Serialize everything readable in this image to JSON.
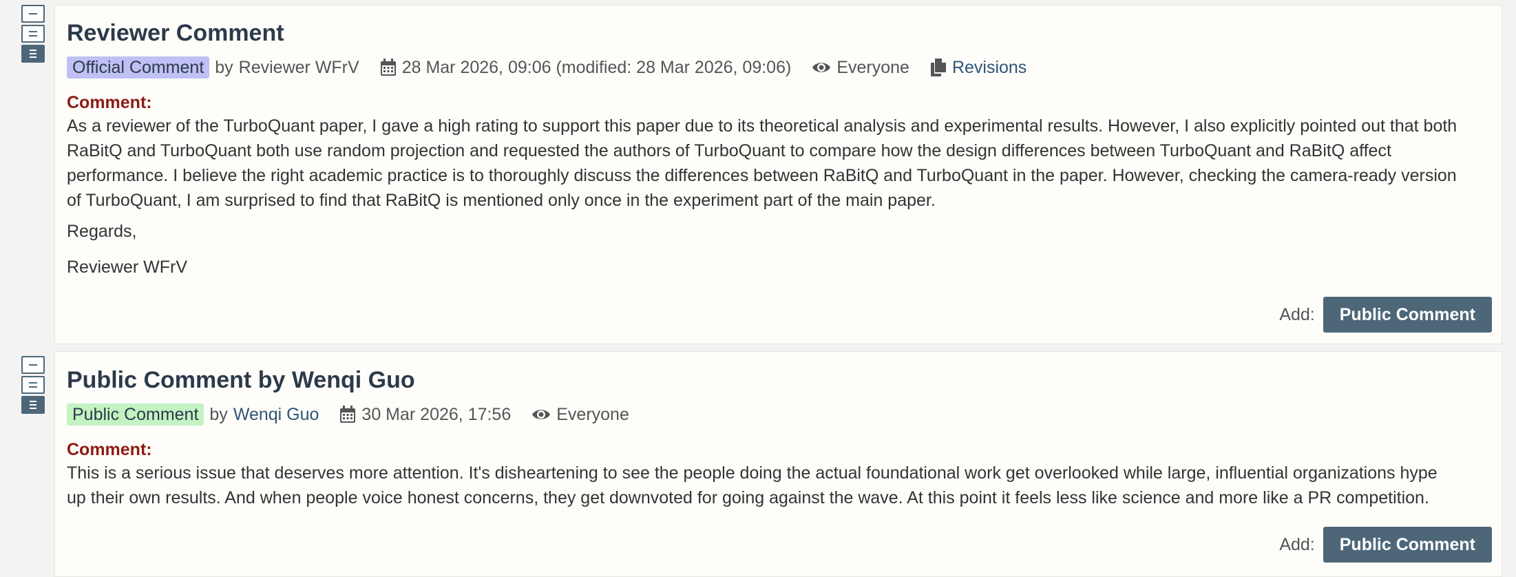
{
  "notes": [
    {
      "title": "Reviewer Comment",
      "invitation_badge": "Official Comment",
      "by_prefix": "by",
      "author": "Reviewer WFrV",
      "date": "28 Mar 2026, 09:06 (modified: 28 Mar 2026, 09:06)",
      "readers": "Everyone",
      "revisions_label": "Revisions",
      "comment_label": "Comment:",
      "comment_lines": [
        "As a reviewer of the TurboQuant paper, I gave a high rating to support this paper due to its theoretical analysis and experimental results. However, I also explicitly pointed out that both",
        "RaBitQ and TurboQuant both use random projection and requested the authors of TurboQuant to compare how the design differences between TurboQuant and RaBitQ affect",
        "performance. I believe the right academic practice is to thoroughly discuss the differences between RaBitQ and TurboQuant in the paper. However, checking the camera-ready version",
        "of TurboQuant, I am surprised to find that RaBitQ is mentioned only once in the experiment part of the main paper."
      ],
      "closing": "Regards,",
      "signature": "Reviewer WFrV",
      "add_label": "Add:",
      "add_button": "Public Comment"
    },
    {
      "title": "Public Comment by Wenqi Guo",
      "invitation_badge": "Public Comment",
      "by_prefix": "by",
      "author": "Wenqi Guo",
      "date": "30 Mar 2026, 17:56",
      "readers": "Everyone",
      "comment_label": "Comment:",
      "comment_lines": [
        "This is a serious issue that deserves more attention. It's disheartening to see the people doing the actual foundational work get overlooked while large, influential organizations hype",
        "up their own results. And when people voice honest concerns, they get downvoted for going against the wave. At this point it feels less like science and more like a PR competition."
      ],
      "add_label": "Add:",
      "add_button": "Public Comment"
    }
  ],
  "colors": {
    "official_badge": "#c0c0f5",
    "public_badge": "#c4f2c2",
    "button": "#4d6779",
    "field_label": "#8c1b13",
    "link": "#2f5577"
  },
  "icons": {
    "collapse": "collapse-icon",
    "summary": "summary-view-icon",
    "expand": "expand-icon",
    "date": "calendar-icon",
    "readers": "eye-icon",
    "revisions": "document-copy-icon"
  }
}
